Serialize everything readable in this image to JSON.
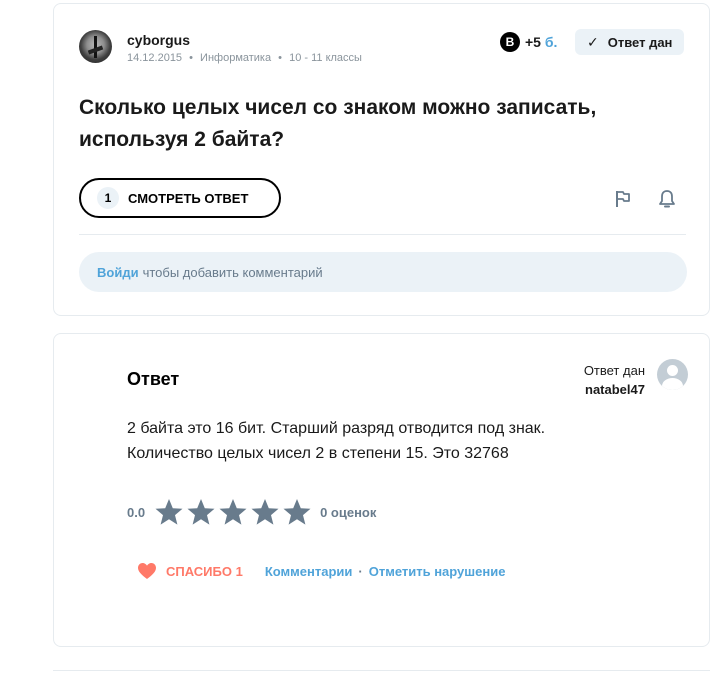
{
  "question": {
    "author": "cyborgus",
    "date": "14.12.2015",
    "subject": "Информатика",
    "grade": "10 - 11 классы",
    "meta_separator": "•",
    "points_icon": "B",
    "points": "+5",
    "points_unit": "б.",
    "answered_check": "✓",
    "answered_label": "Ответ дан",
    "title": "Сколько целых чисел со знаком можно записать, используя 2 байта?",
    "view_answer_count": "1",
    "view_answer_label": "СМОТРЕТЬ ОТВЕТ",
    "icons": {
      "flag": "flag-icon",
      "bell": "bell-icon"
    },
    "comment_login": "Войди",
    "comment_text": "чтобы добавить комментарий"
  },
  "answer": {
    "heading": "Ответ",
    "answered_by_label": "Ответ дан",
    "answered_by_user": "natabel47",
    "text_line1": "2 байта это 16 бит. Старший разряд отводится под знак.",
    "text_line2": "Количество целых чисел 2 в степени 15. Это 32768",
    "rating_value": "0.0",
    "rating_stars": 0,
    "rating_max": 5,
    "rating_count": "0 оценок",
    "thanks_label": "СПАСИБО 1",
    "comments_label": "Комментарии",
    "separator": "·",
    "report_label": "Отметить нарушение"
  },
  "colors": {
    "accent_blue": "#4fa3d9",
    "thanks_red": "#ff7968",
    "star_gray": "#687b8c",
    "pill_bg": "#ebf2f7"
  }
}
